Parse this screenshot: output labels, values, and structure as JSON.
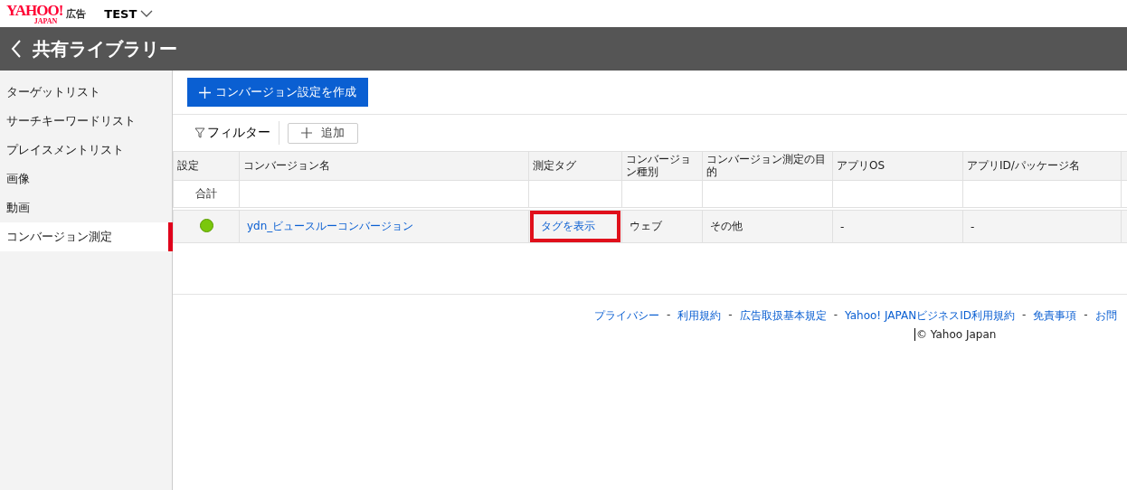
{
  "header": {
    "logo": "YAHOO!",
    "logo_sub": "JAPAN",
    "service": "広告",
    "account": "TEST"
  },
  "title_bar": {
    "title": "共有ライブラリー"
  },
  "sidebar": {
    "items": [
      {
        "label": "ターゲットリスト",
        "selected": false
      },
      {
        "label": "サーチキーワードリスト",
        "selected": false
      },
      {
        "label": "プレイスメントリスト",
        "selected": false
      },
      {
        "label": "画像",
        "selected": false
      },
      {
        "label": "動画",
        "selected": false
      },
      {
        "label": "コンバージョン測定",
        "selected": true
      }
    ]
  },
  "create_button": "コンバージョン設定を作成",
  "toolbar": {
    "filter": "フィルター",
    "add": "追加"
  },
  "table": {
    "columns": [
      "設定",
      "コンバージョン名",
      "測定タグ",
      "コンバージョン種別",
      "コンバージョン測定の目的",
      "アプリOS",
      "アプリID/パッケージ名",
      ""
    ],
    "total_label": "合計",
    "rows": [
      {
        "on": true,
        "name": "ydn_ビュースルーコンバージョン",
        "tag": "タグを表示",
        "tag_highlighted": true,
        "type": "ウェブ",
        "purpose": "その他",
        "os": "-",
        "app_id": "-"
      }
    ]
  },
  "footer": {
    "links": [
      "プライバシー",
      "利用規約",
      "広告取扱基本規定",
      "Yahoo! JAPANビジネスID利用規約",
      "免責事項",
      "お問"
    ],
    "separator": "-",
    "copyright": "© Yahoo Japan"
  }
}
